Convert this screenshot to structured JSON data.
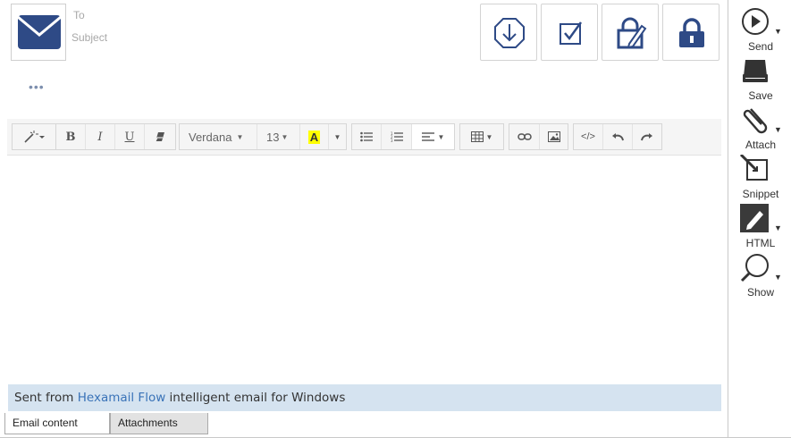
{
  "header": {
    "to_label": "To",
    "subject_label": "Subject",
    "more_dots": "•••"
  },
  "actions": [
    {
      "name": "download-icon"
    },
    {
      "name": "checkbox-icon"
    },
    {
      "name": "edit-lock-icon"
    },
    {
      "name": "lock-icon"
    }
  ],
  "toolbar": {
    "bold": "B",
    "italic": "I",
    "underline": "U",
    "font_name": "Verdana",
    "font_size": "13",
    "font_color_letter": "A",
    "code": "</>"
  },
  "signature": {
    "prefix": "Sent from ",
    "link": "Hexamail Flow",
    "suffix": " intelligent email for Windows"
  },
  "tabs": {
    "email_content": "Email content",
    "attachments": "Attachments"
  },
  "sidebar": {
    "send": "Send",
    "save": "Save",
    "attach": "Attach",
    "snippet": "Snippet",
    "html": "HTML",
    "show": "Show"
  },
  "colors": {
    "accent": "#2e4a86",
    "signature_bg": "#d5e3f0",
    "link": "#3a73b8"
  }
}
